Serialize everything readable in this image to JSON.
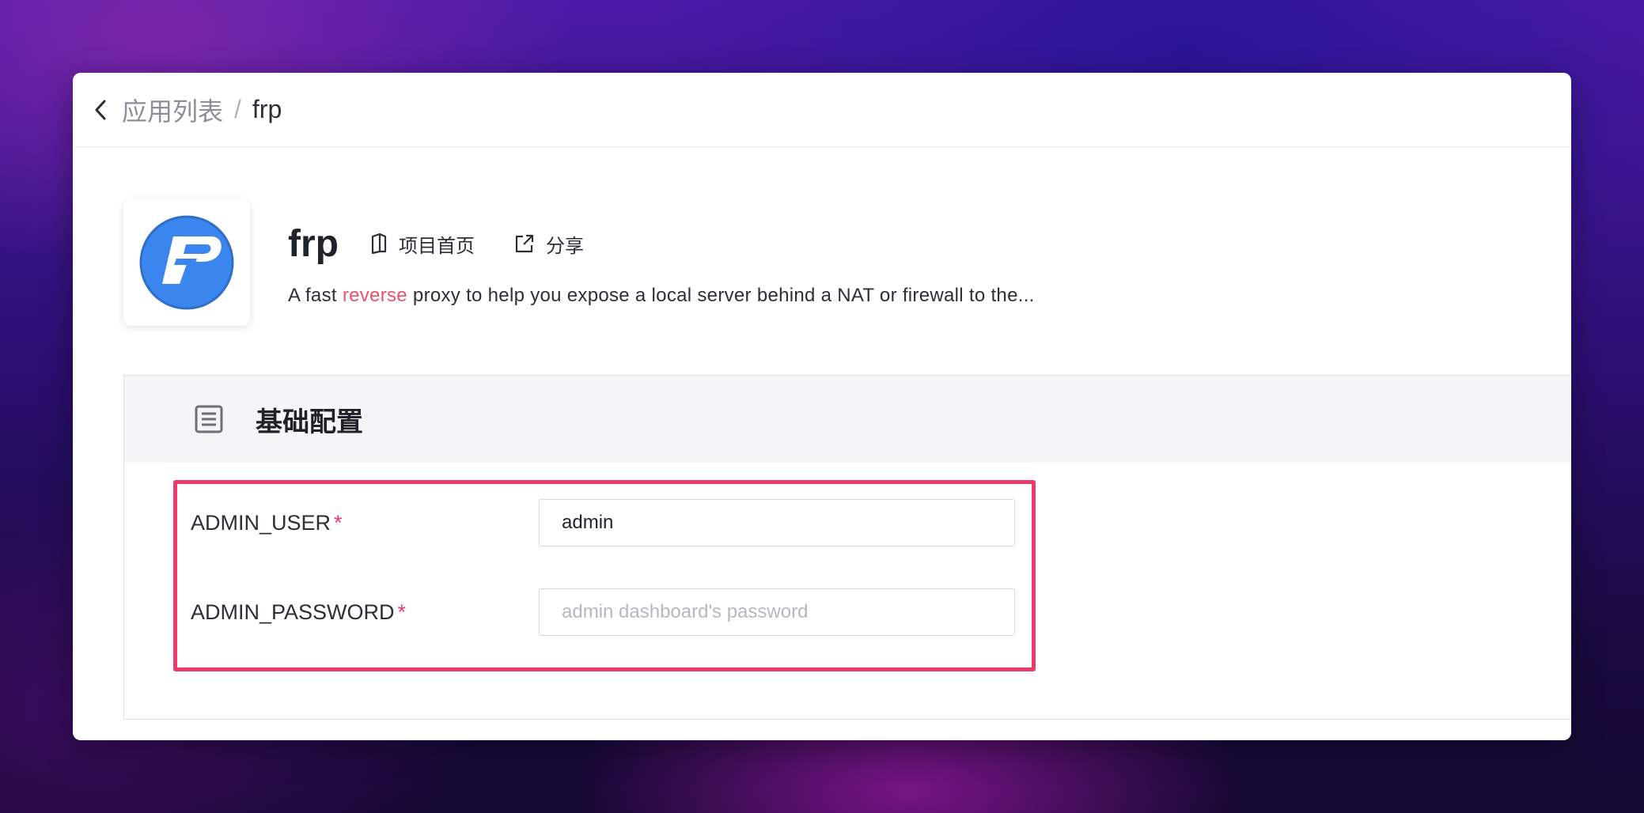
{
  "breadcrumb": {
    "parent": "应用列表",
    "separator": "/",
    "current": "frp"
  },
  "app": {
    "name": "frp",
    "homepage_label": "项目首页",
    "share_label": "分享",
    "description_before": "A fast ",
    "description_highlight": "reverse",
    "description_after": " proxy to help you expose a local server behind a NAT or firewall to the..."
  },
  "config": {
    "section_title": "基础配置",
    "fields": [
      {
        "label": "ADMIN_USER",
        "required_mark": "*",
        "value": "admin",
        "placeholder": ""
      },
      {
        "label": "ADMIN_PASSWORD",
        "required_mark": "*",
        "value": "",
        "placeholder": "admin dashboard's password"
      }
    ]
  },
  "colors": {
    "accent_pink": "#ee3a6a",
    "logo_blue": "#3a86ee"
  },
  "icons": {
    "back": "chevron-left-icon",
    "homepage": "book-icon",
    "share": "external-link-icon",
    "section": "document-icon",
    "logo": "frp-logo"
  }
}
